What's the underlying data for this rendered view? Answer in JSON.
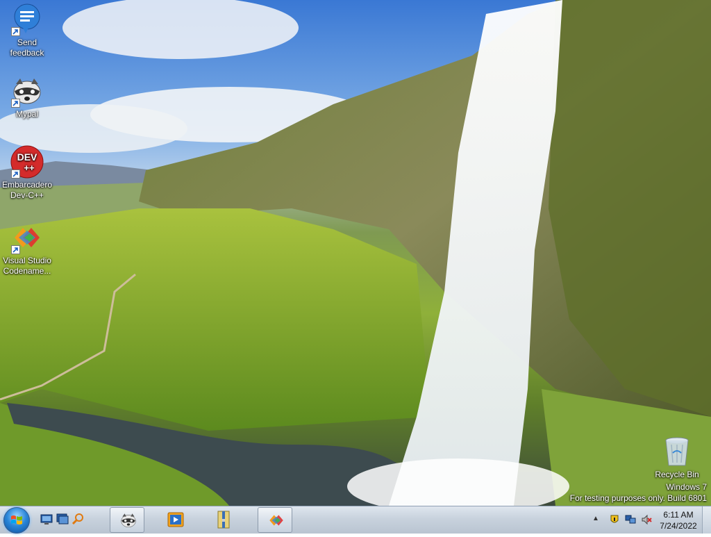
{
  "desktop": {
    "icons": [
      {
        "name": "Send feedback",
        "line1": "Send",
        "line2": "feedback"
      },
      {
        "name": "Mypal",
        "line1": "Mypal",
        "line2": ""
      },
      {
        "name": "Embarcadero Dev-C++",
        "line1": "Embarcadero",
        "line2": "Dev-C++",
        "badge_top": "DEV",
        "badge_bottom": "++"
      },
      {
        "name": "Visual Studio Codename...",
        "line1": "Visual Studio",
        "line2": "Codename..."
      },
      {
        "name": "Recycle Bin",
        "line1": "Recycle Bin",
        "line2": ""
      }
    ],
    "watermark": {
      "line1": "Windows 7",
      "line2": "For testing purposes only. Build 6801"
    }
  },
  "taskbar": {
    "quick_launch": [
      "show-desktop-icon",
      "switch-windows-icon",
      "search-icon"
    ],
    "buttons": [
      {
        "icon": "mypal-icon",
        "active": true
      },
      {
        "icon": "media-player-icon",
        "active": false
      },
      {
        "icon": "archive-icon",
        "active": false
      },
      {
        "icon": "visual-studio-icon",
        "active": true
      }
    ],
    "tray": {
      "expand_glyph": "▲",
      "icons": [
        "action-center-icon",
        "network-icon",
        "volume-muted-icon"
      ]
    },
    "clock": {
      "time": "6:11 AM",
      "date": "7/24/2022"
    }
  },
  "colors": {
    "taskbar": "#c8d2dd",
    "accent": "#2a86d9"
  }
}
